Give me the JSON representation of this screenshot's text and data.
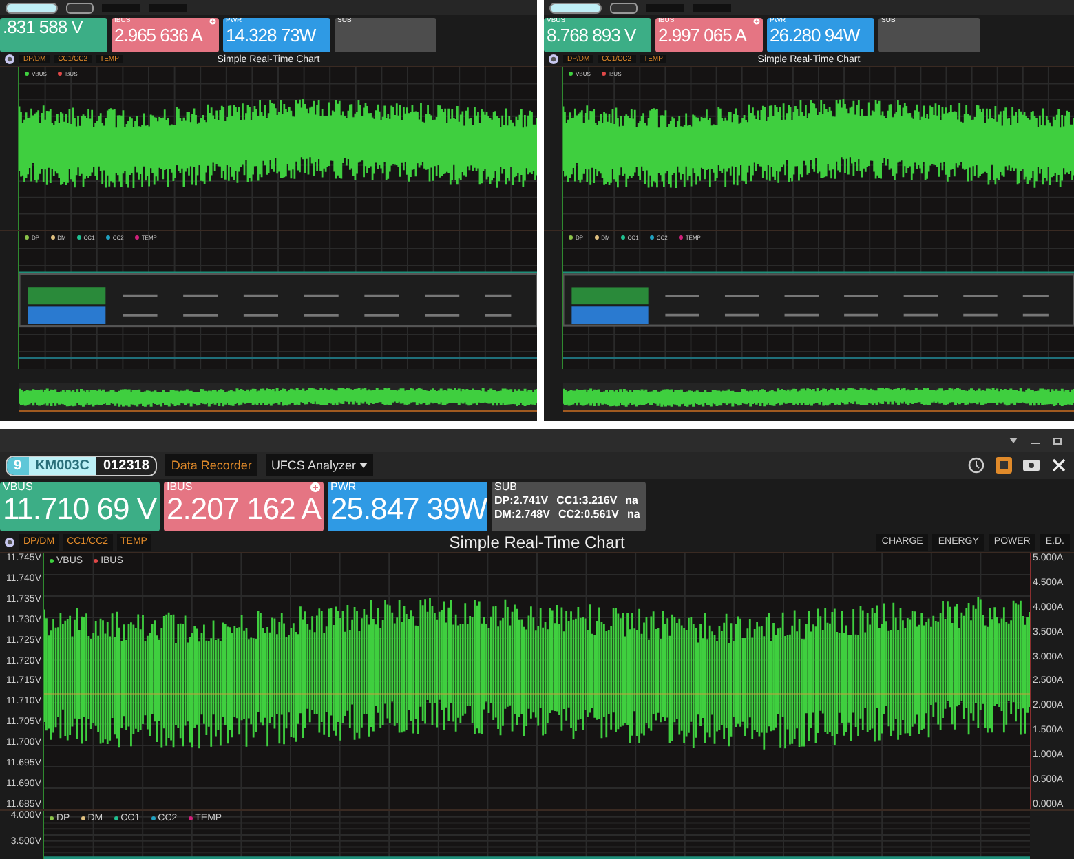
{
  "panels": [
    {
      "kind": "compact",
      "readouts": [
        {
          "value": ".831 588 V",
          "color": "#3cae86"
        },
        {
          "label": "IBUS",
          "value": "2.965 636 A",
          "color": "#e57583"
        },
        {
          "label": "PWR",
          "value": "14.328 73W",
          "color": "#2f9ae4"
        },
        {
          "label": "SUB",
          "color": "#4d4d4d"
        }
      ],
      "chart_buttons": [
        "DP/DM",
        "CC1/CC2",
        "TEMP"
      ],
      "chart_title": "Simple Real-Time Chart",
      "main_legend": [
        {
          "label": "VBUS",
          "color": "#3fd03f"
        },
        {
          "label": "IBUS",
          "color": "#e04848"
        }
      ],
      "sub_legend": [
        {
          "label": "DP",
          "color": "#8bc34a"
        },
        {
          "label": "DM",
          "color": "#e0c080"
        },
        {
          "label": "CC1",
          "color": "#20c090"
        },
        {
          "label": "CC2",
          "color": "#20a0c0"
        },
        {
          "label": "TEMP",
          "color": "#d0207a"
        }
      ]
    },
    {
      "kind": "compact",
      "readouts": [
        {
          "label": "VBUS",
          "value": "8.768 893 V",
          "color": "#3cae86"
        },
        {
          "label": "IBUS",
          "value": "2.997 065 A",
          "color": "#e57583"
        },
        {
          "label": "PWR",
          "value": "26.280 94W",
          "color": "#2f9ae4"
        },
        {
          "label": "SUB",
          "color": "#4d4d4d"
        }
      ],
      "chart_buttons": [
        "DP/DM",
        "CC1/CC2",
        "TEMP"
      ],
      "chart_title": "Simple Real-Time Chart",
      "main_legend": [
        {
          "label": "VBUS",
          "color": "#3fd03f"
        },
        {
          "label": "IBUS",
          "color": "#e04848"
        }
      ],
      "sub_legend": [
        {
          "label": "DP",
          "color": "#8bc34a"
        },
        {
          "label": "DM",
          "color": "#e0c080"
        },
        {
          "label": "CC1",
          "color": "#20c090"
        },
        {
          "label": "CC2",
          "color": "#20a0c0"
        },
        {
          "label": "TEMP",
          "color": "#d0207a"
        }
      ]
    },
    {
      "kind": "full",
      "device": {
        "slot": "9",
        "model": "KM003C",
        "serial": "012318"
      },
      "tools": [
        "Data Recorder",
        "UFCS Analyzer"
      ],
      "readouts": [
        {
          "label": "VBUS",
          "value": "11.710 69 V",
          "color": "#3cae86"
        },
        {
          "label": "IBUS",
          "value": "2.207 162 A",
          "color": "#e57583"
        },
        {
          "label": "PWR",
          "value": "25.847 39W",
          "color": "#2f9ae4"
        },
        {
          "label": "SUB",
          "color": "#4d4d4d",
          "lines": [
            [
              "DP:2.741V",
              "CC1:3.216V",
              "na"
            ],
            [
              "DM:2.748V",
              "CC2:0.561V",
              "na"
            ]
          ]
        }
      ],
      "chart_buttons": [
        "DP/DM",
        "CC1/CC2",
        "TEMP"
      ],
      "chart_title": "Simple Real-Time Chart",
      "view_buttons": [
        "CHARGE",
        "ENERGY",
        "POWER",
        "E.D."
      ],
      "left_ticks": [
        "11.745V",
        "11.740V",
        "11.735V",
        "11.730V",
        "11.725V",
        "11.720V",
        "11.715V",
        "11.710V",
        "11.705V",
        "11.700V",
        "11.695V",
        "11.690V",
        "11.685V"
      ],
      "right_ticks": [
        "5.000A",
        "4.500A",
        "4.000A",
        "3.500A",
        "3.000A",
        "2.500A",
        "2.000A",
        "1.500A",
        "1.000A",
        "0.500A",
        "0.000A"
      ],
      "main_legend": [
        {
          "label": "VBUS",
          "color": "#3fd03f"
        },
        {
          "label": "IBUS",
          "color": "#e04848"
        }
      ],
      "sub_ticks": [
        "4.000V",
        "3.500V"
      ],
      "sub_legend": [
        {
          "label": "DP",
          "color": "#8bc34a"
        },
        {
          "label": "DM",
          "color": "#e0c080"
        },
        {
          "label": "CC1",
          "color": "#20c090"
        },
        {
          "label": "CC2",
          "color": "#20a0c0"
        },
        {
          "label": "TEMP",
          "color": "#d0207a"
        }
      ]
    }
  ]
}
